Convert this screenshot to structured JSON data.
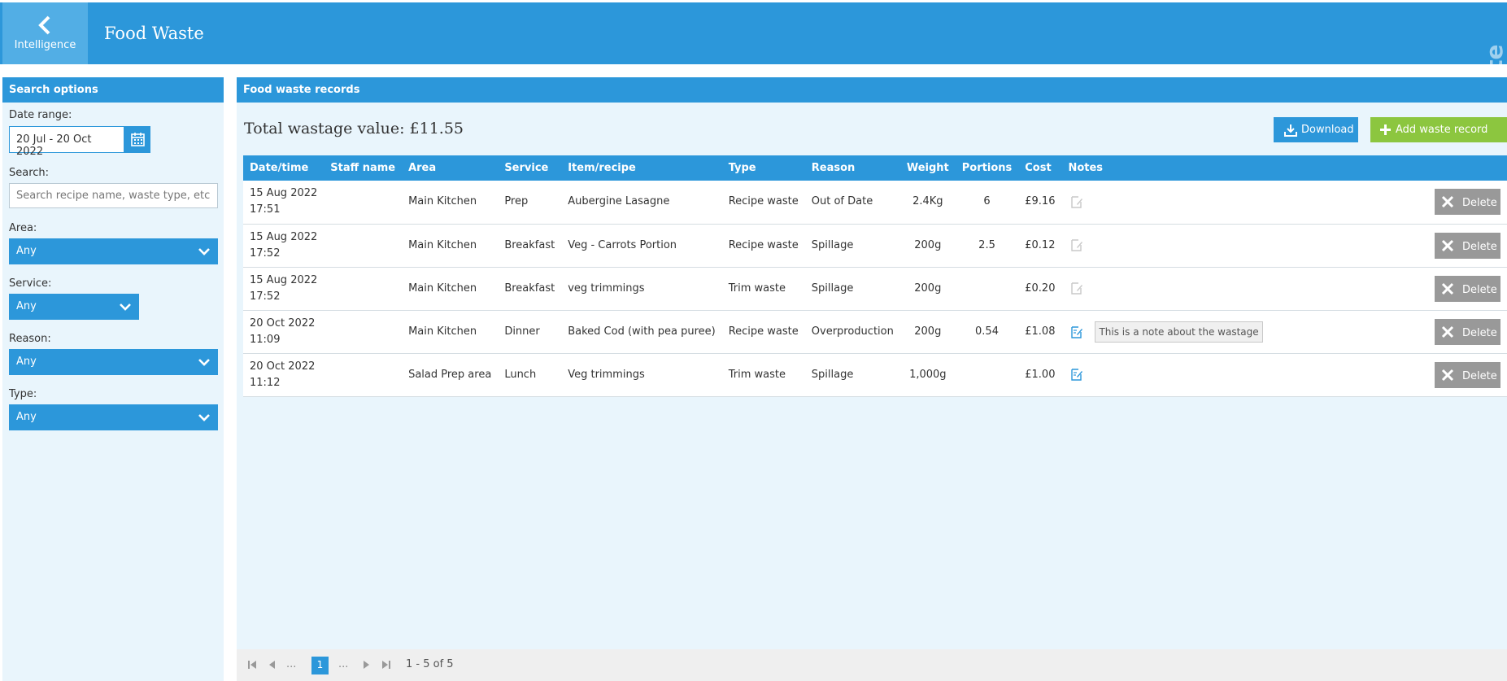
{
  "header": {
    "back_label": "Intelligence",
    "title": "Food Waste",
    "watermark": "Demo Site"
  },
  "search": {
    "panel_title": "Search options",
    "date_range_label": "Date range:",
    "date_range_value": "20 Jul - 20 Oct 2022",
    "search_label": "Search:",
    "search_placeholder": "Search recipe name, waste type, etc",
    "area_label": "Area:",
    "area_value": "Any",
    "service_label": "Service:",
    "service_value": "Any",
    "reason_label": "Reason:",
    "reason_value": "Any",
    "type_label": "Type:",
    "type_value": "Any"
  },
  "records": {
    "panel_title": "Food waste records",
    "total_value": "Total wastage value: £11.55",
    "download_label": "Download",
    "add_label": "Add waste record",
    "columns": [
      "Date/time",
      "Staff name",
      "Area",
      "Service",
      "Item/recipe",
      "Type",
      "Reason",
      "Weight",
      "Portions",
      "Cost",
      "Notes"
    ],
    "delete_label": "Delete",
    "rows": [
      {
        "date": "15 Aug 2022",
        "time": "17:51",
        "staff": "",
        "area": "Main Kitchen",
        "service": "Prep",
        "item": "Aubergine Lasagne",
        "type": "Recipe waste",
        "reason": "Out of Date",
        "weight": "2.4Kg",
        "portions": "6",
        "cost": "£9.16",
        "has_note": false,
        "note": ""
      },
      {
        "date": "15 Aug 2022",
        "time": "17:52",
        "staff": "",
        "area": "Main Kitchen",
        "service": "Breakfast",
        "item": "Veg - Carrots Portion",
        "type": "Recipe waste",
        "reason": "Spillage",
        "weight": "200g",
        "portions": "2.5",
        "cost": "£0.12",
        "has_note": false,
        "note": ""
      },
      {
        "date": "15 Aug 2022",
        "time": "17:52",
        "staff": "",
        "area": "Main Kitchen",
        "service": "Breakfast",
        "item": "veg trimmings",
        "type": "Trim waste",
        "reason": "Spillage",
        "weight": "200g",
        "portions": "",
        "cost": "£0.20",
        "has_note": false,
        "note": ""
      },
      {
        "date": "20 Oct 2022",
        "time": "11:09",
        "staff": "",
        "area": "Main Kitchen",
        "service": "Dinner",
        "item": "Baked Cod (with pea puree)",
        "type": "Recipe waste",
        "reason": "Overproduction",
        "weight": "200g",
        "portions": "0.54",
        "cost": "£1.08",
        "has_note": true,
        "note": "This is a note about the wastage"
      },
      {
        "date": "20 Oct 2022",
        "time": "11:12",
        "staff": "",
        "area": "Salad Prep area",
        "service": "Lunch",
        "item": "Veg trimmings",
        "type": "Trim waste",
        "reason": "Spillage",
        "weight": "1,000g",
        "portions": "",
        "cost": "£1.00",
        "has_note": true,
        "note": ""
      }
    ]
  },
  "pagination": {
    "ellipsis": "...",
    "current_page": "1",
    "summary": "1 - 5 of 5"
  },
  "colors": {
    "primary": "#2c97da",
    "panel_bg": "#e9f5fc",
    "add_green": "#8cc63f",
    "delete_gray": "#999999"
  }
}
